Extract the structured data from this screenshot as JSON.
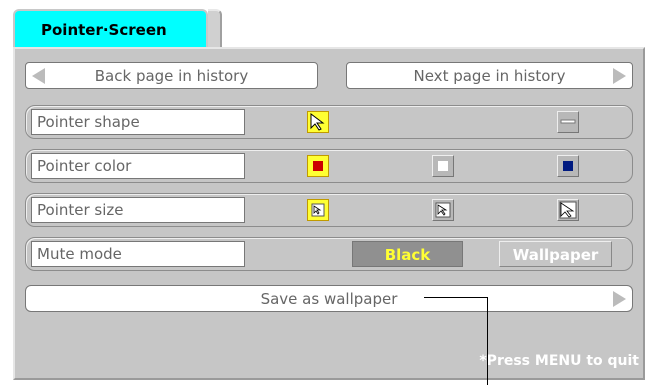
{
  "tab": {
    "label": "Pointer·Screen",
    "color": "#00ffff"
  },
  "nav": {
    "back_label": "Back page in history",
    "next_label": "Next page in history"
  },
  "rows": {
    "shape_label": "Pointer shape",
    "color_label": "Pointer color",
    "size_label": "Pointer size",
    "mute_label": "Mute mode",
    "mute_options": [
      "Black",
      "Wallpaper"
    ],
    "mute_selected": "Black"
  },
  "colors": {
    "selected": "#ffff33",
    "red": "#cc0000",
    "navy": "#001a80",
    "panel": "#c6c6c6"
  },
  "save": {
    "label": "Save as wallpaper"
  },
  "footer": {
    "note": "*Press MENU to quit"
  }
}
